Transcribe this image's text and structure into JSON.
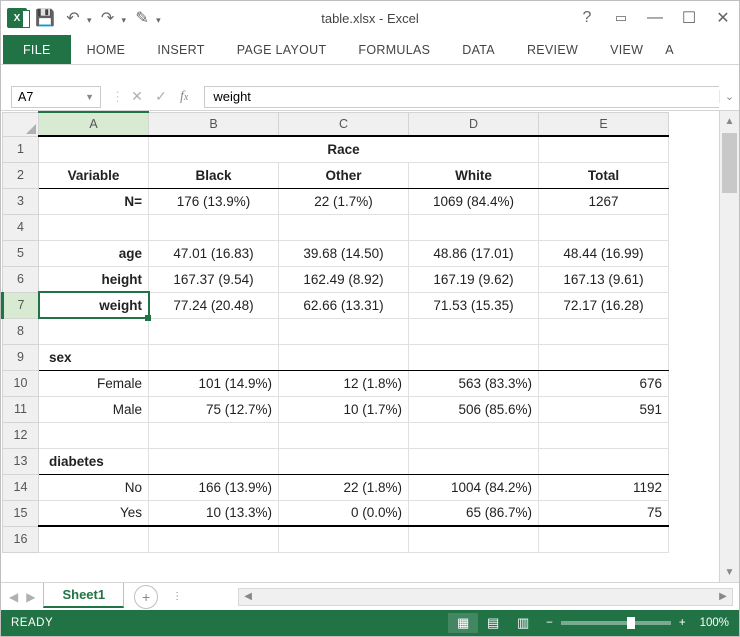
{
  "window": {
    "title": "table.xlsx - Excel"
  },
  "ribbon": {
    "file": "FILE",
    "tabs": [
      "HOME",
      "INSERT",
      "PAGE LAYOUT",
      "FORMULAS",
      "DATA",
      "REVIEW",
      "VIEW",
      "A"
    ]
  },
  "namebox": {
    "value": "A7"
  },
  "formula": {
    "value": "weight"
  },
  "columns": [
    "A",
    "B",
    "C",
    "D",
    "E"
  ],
  "sheet": {
    "header_span": "Race",
    "r2": {
      "a": "Variable",
      "b": "Black",
      "c": "Other",
      "d": "White",
      "e": "Total"
    },
    "r3": {
      "a": "N=",
      "b": "176 (13.9%)",
      "c": "22 (1.7%)",
      "d": "1069 (84.4%)",
      "e": "1267"
    },
    "r5": {
      "a": "age",
      "b": "47.01 (16.83)",
      "c": "39.68 (14.50)",
      "d": "48.86 (17.01)",
      "e": "48.44 (16.99)"
    },
    "r6": {
      "a": "height",
      "b": "167.37 (9.54)",
      "c": "162.49 (8.92)",
      "d": "167.19 (9.62)",
      "e": "167.13 (9.61)"
    },
    "r7": {
      "a": "weight",
      "b": "77.24 (20.48)",
      "c": "62.66 (13.31)",
      "d": "71.53 (15.35)",
      "e": "72.17 (16.28)"
    },
    "r9": {
      "a": "sex"
    },
    "r10": {
      "a": "Female",
      "b": "101 (14.9%)",
      "c": "12 (1.8%)",
      "d": "563 (83.3%)",
      "e": "676"
    },
    "r11": {
      "a": "Male",
      "b": "75 (12.7%)",
      "c": "10 (1.7%)",
      "d": "506 (85.6%)",
      "e": "591"
    },
    "r13": {
      "a": "diabetes"
    },
    "r14": {
      "a": "No",
      "b": "166 (13.9%)",
      "c": "22 (1.8%)",
      "d": "1004 (84.2%)",
      "e": "1192"
    },
    "r15": {
      "a": "Yes",
      "b": "10 (13.3%)",
      "c": "0 (0.0%)",
      "d": "65 (86.7%)",
      "e": "75"
    }
  },
  "sheet_tab": "Sheet1",
  "status": {
    "ready": "READY",
    "zoom": "100%"
  },
  "chart_data": {
    "type": "table",
    "title": "Race",
    "columns": [
      "Variable",
      "Black",
      "Other",
      "White",
      "Total"
    ],
    "rows": [
      [
        "N=",
        "176 (13.9%)",
        "22 (1.7%)",
        "1069 (84.4%)",
        "1267"
      ],
      [
        "age",
        "47.01 (16.83)",
        "39.68 (14.50)",
        "48.86 (17.01)",
        "48.44 (16.99)"
      ],
      [
        "height",
        "167.37 (9.54)",
        "162.49 (8.92)",
        "167.19 (9.62)",
        "167.13 (9.61)"
      ],
      [
        "weight",
        "77.24 (20.48)",
        "62.66 (13.31)",
        "71.53 (15.35)",
        "72.17 (16.28)"
      ],
      [
        "sex",
        "",
        "",
        "",
        ""
      ],
      [
        "Female",
        "101 (14.9%)",
        "12 (1.8%)",
        "563 (83.3%)",
        "676"
      ],
      [
        "Male",
        "75 (12.7%)",
        "10 (1.7%)",
        "506 (85.6%)",
        "591"
      ],
      [
        "diabetes",
        "",
        "",
        "",
        ""
      ],
      [
        "No",
        "166 (13.9%)",
        "22 (1.8%)",
        "1004 (84.2%)",
        "1192"
      ],
      [
        "Yes",
        "10 (13.3%)",
        "0 (0.0%)",
        "65 (86.7%)",
        "75"
      ]
    ]
  }
}
